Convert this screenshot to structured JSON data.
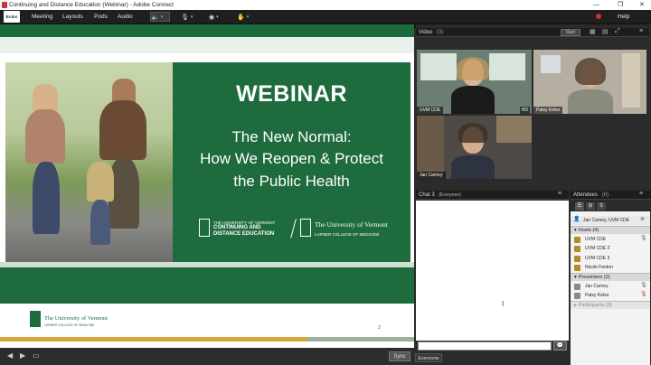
{
  "window": {
    "title": "Continuing and Distance Education (Webinar) - Adobe Connect",
    "controls": [
      "—",
      "❐",
      "✕"
    ]
  },
  "menu": {
    "logo": "Brabo",
    "items": [
      "Meeting",
      "Layouts",
      "Pods",
      "Audio"
    ],
    "help": "Help"
  },
  "slide": {
    "heading": "WEBINAR",
    "title_lines": [
      "The New Normal:",
      "How We Reopen & Protect",
      "the Public Health"
    ],
    "logo_left": [
      "THE UNIVERSITY OF VERMONT",
      "CONTINUING AND",
      "DISTANCE EDUCATION"
    ],
    "logo_right": [
      "The University of Vermont",
      "LARNER COLLEGE OF MEDICINE"
    ],
    "footer_logo": [
      "The University of Vermont",
      "LARNER COLLEGE OF MEDICINE"
    ],
    "page_number": "2"
  },
  "presentation_bar": {
    "sync_label": "Sync"
  },
  "video_pod": {
    "title": "Video",
    "count": "(3)",
    "start_label": "Start",
    "feeds": [
      {
        "name": "UVM CDE",
        "badge": "HD"
      },
      {
        "name": "Patsy Kelso"
      },
      {
        "name": "Jan Carney"
      }
    ]
  },
  "chat_pod": {
    "title": "Chat 3",
    "audience": "(Everyone)",
    "target_label": "Everyone"
  },
  "attendees_pod": {
    "title": "Attendees",
    "count": "(6)",
    "self": "Jan Carney, UVM CDE",
    "groups": [
      {
        "label": "Hosts (4)",
        "members": [
          "UVM CDE",
          "UVM CDE 2",
          "UVM CDE 3",
          "Nicole Fenton"
        ]
      },
      {
        "label": "Presenters (2)",
        "members": [
          "Jan Carney",
          "Patsy Kelso"
        ]
      },
      {
        "label": "Participants (0)",
        "members": []
      }
    ]
  },
  "colors": {
    "uvm_green": "#1e6b3e",
    "gold": "#d4a93a",
    "record_red": "#d0302f",
    "mic_green": "#36d36a"
  }
}
